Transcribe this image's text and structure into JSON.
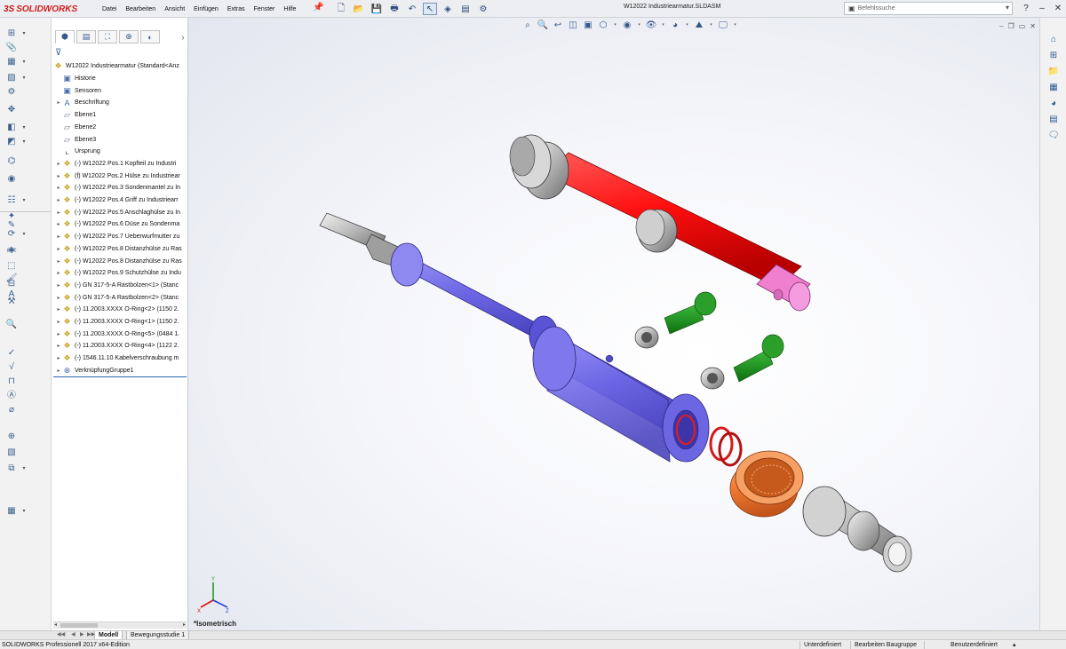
{
  "app": {
    "logo_text": "SOLIDWORKS",
    "menu": [
      "Datei",
      "Bearbeiten",
      "Ansicht",
      "Einfügen",
      "Extras",
      "Fenster",
      "Hilfe"
    ],
    "document_title": "W12022 Industriearmatur.SLDASM",
    "search_placeholder": "Befehlssuche",
    "accent_color": "#d21f1f"
  },
  "feature_manager": {
    "root": "W12022 Industriearmatur  (Standard<Anz",
    "items": [
      {
        "label": "Historie",
        "icon": "folder-icon",
        "expandable": false
      },
      {
        "label": "Sensoren",
        "icon": "sensor-icon",
        "expandable": false
      },
      {
        "label": "Beschriftung",
        "icon": "annotation-icon",
        "expandable": true
      },
      {
        "label": "Ebene1",
        "icon": "plane-icon",
        "expandable": false
      },
      {
        "label": "Ebene2",
        "icon": "plane-icon",
        "expandable": false
      },
      {
        "label": "Ebene3",
        "icon": "plane-icon",
        "expandable": false
      },
      {
        "label": "Ursprung",
        "icon": "origin-icon",
        "expandable": false
      },
      {
        "label": "(-) W12022 Pos.1 Kopfteil zu Industri",
        "icon": "part-icon",
        "expandable": true
      },
      {
        "label": "(f) W12022 Pos.2 Hülse zu Industriear",
        "icon": "part-icon",
        "expandable": true
      },
      {
        "label": "(-) W12022 Pos.3 Sondenmantel zu In",
        "icon": "part-icon",
        "expandable": true
      },
      {
        "label": "(-) W12022 Pos.4 Griff zu Industriearr",
        "icon": "part-icon",
        "expandable": true
      },
      {
        "label": "(-) W12022 Pos.5 Anschlaghülse zu In",
        "icon": "part-icon",
        "expandable": true
      },
      {
        "label": "(-) W12022 Pos.6 Düse zu Sondenma",
        "icon": "part-icon",
        "expandable": true
      },
      {
        "label": "(-) W12022 Pos.7 Ueberwurfmutter zu",
        "icon": "part-icon",
        "expandable": true
      },
      {
        "label": "(-) W12022 Pos.8 Distanzhülse zu Ras",
        "icon": "part-icon",
        "expandable": true
      },
      {
        "label": "(-) W12022 Pos.8 Distanzhülse zu Ras",
        "icon": "part-icon",
        "expandable": true
      },
      {
        "label": "(-) W12022 Pos.9 Schutzhülse zu Indu",
        "icon": "part-icon",
        "expandable": true
      },
      {
        "label": "(-) GN 317-5-A Rastbolzen<1> (Stanc",
        "icon": "part-icon",
        "expandable": true
      },
      {
        "label": "(-) GN 317-5-A Rastbolzen<2> (Stanc",
        "icon": "part-icon",
        "expandable": true
      },
      {
        "label": "(-) 11.2003.XXXX O-Ring<2> (1150 2.",
        "icon": "part-icon",
        "expandable": true
      },
      {
        "label": "(-) 11.2003.XXXX O-Ring<1> (1150 2.",
        "icon": "part-icon",
        "expandable": true
      },
      {
        "label": "(-) 11.2003.XXXX O-Ring<5> (0484 1.",
        "icon": "part-icon",
        "expandable": true
      },
      {
        "label": "(-) 11.2003.XXXX O-Ring<4> (1122 2.",
        "icon": "part-icon",
        "expandable": true
      },
      {
        "label": "(-) 1546.11.10 Kabelverschraubung m",
        "icon": "part-icon",
        "expandable": true
      },
      {
        "label": "VerknüpfungGruppe1",
        "icon": "mate-group-icon",
        "expandable": true
      }
    ]
  },
  "graphics": {
    "view_label": "*Isometrisch",
    "part_colors": {
      "rod": "#ff1010",
      "sleeve": "#7b74ec",
      "nut": "#f07a30",
      "bolts": "#1f8f1f",
      "end_cap": "#f07fd0",
      "oring": "#d81818",
      "steel": "#b8b8b8"
    }
  },
  "bottom_tabs": [
    "Modell",
    "Bewegungsstudie 1"
  ],
  "status": {
    "edition": "SOLIDWORKS Professionell 2017 x64-Edition",
    "definition": "Unterdefiniert",
    "mode": "Bearbeiten Baugruppe",
    "units": "Benutzerdefiniert"
  }
}
